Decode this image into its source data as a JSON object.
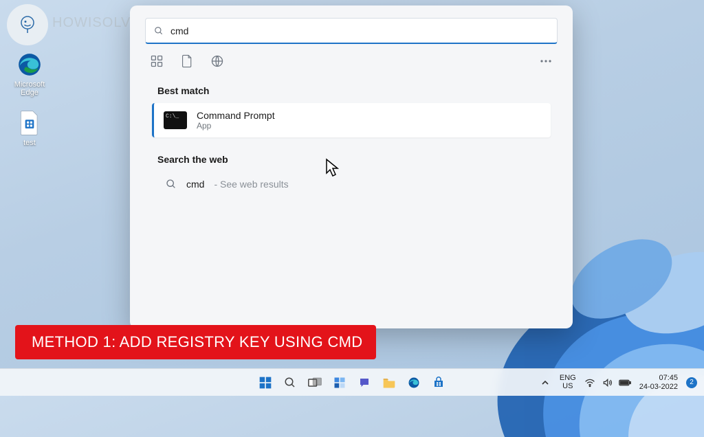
{
  "watermark": "HOWISOLVE.COM",
  "desktop": [
    {
      "label": "Microsoft Edge"
    },
    {
      "label": "test"
    }
  ],
  "search": {
    "value": "cmd",
    "best_match_heading": "Best match",
    "result": {
      "title": "Command Prompt",
      "subtitle": "App"
    },
    "web_heading": "Search the web",
    "web_item": {
      "term": "cmd",
      "hint": "- See web results"
    }
  },
  "banner": "METHOD 1: ADD REGISTRY KEY USING CMD",
  "taskbar": {
    "lang1": "ENG",
    "lang2": "US",
    "time": "07:45",
    "date": "24-03-2022",
    "notif_count": "2"
  }
}
